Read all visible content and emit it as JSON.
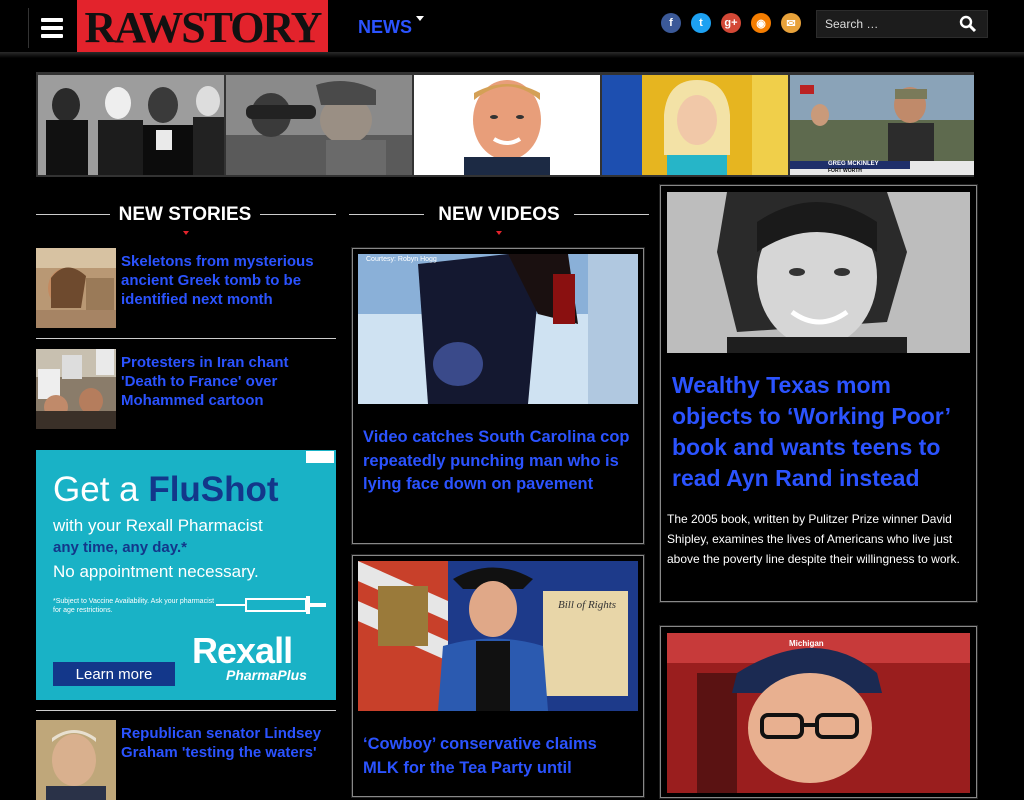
{
  "header": {
    "logo_text": "RAWSTORY",
    "nav_news": "NEWS",
    "search_placeholder": "Search …",
    "social": [
      {
        "icon": "facebook-icon",
        "glyph": "f",
        "color": "#3b5998"
      },
      {
        "icon": "twitter-icon",
        "glyph": "t",
        "color": "#1da1f2"
      },
      {
        "icon": "googleplus-icon",
        "glyph": "g+",
        "color": "#d34836"
      },
      {
        "icon": "rss-icon",
        "glyph": "◉",
        "color": "#f57d00"
      },
      {
        "icon": "email-icon",
        "glyph": "✉",
        "color": "#e8a23a"
      }
    ]
  },
  "strip": {
    "captions": [
      "GREG MCKINLEY",
      "FORT WORTH"
    ]
  },
  "new_stories": {
    "heading": "NEW STORIES",
    "items": [
      {
        "title": "Skeletons from mysterious ancient Greek tomb to be identified next month"
      },
      {
        "title": "Protesters in Iran chant 'Death to France' over Mohammed cartoon"
      },
      {
        "title": "Republican senator Lindsey Graham 'testing the waters'"
      }
    ]
  },
  "new_videos": {
    "heading": "NEW VIDEOS",
    "items": [
      {
        "title": "Video catches South Carolina cop repeatedly punching man who is lying face down on pavement",
        "credit": "Courtesy: Robyn Hogg"
      },
      {
        "title": "‘Cowboy’ conservative claims MLK for the Tea Party until",
        "sign_text": "Bill of Rights"
      }
    ]
  },
  "featured": [
    {
      "title": "Wealthy Texas mom objects to ‘Working Poor’ book and wants teens to read Ayn Rand instead",
      "excerpt": "The 2005 book, written by Pulitzer Prize winner David Shipley, examines the lives of Americans who live just above the poverty line despite their willingness to work."
    },
    {
      "cap_text": "Michigan"
    }
  ],
  "ad": {
    "line1_a": "Get a ",
    "line1_b": "FluShot",
    "line2": "with your Rexall Pharmacist",
    "line3": "any time, any day.*",
    "line4": "No appointment necessary.",
    "fine_print": "*Subject to Vaccine Availability. Ask your pharmacist for age restrictions.",
    "brand": "Rexall",
    "brand_sub": "PharmaPlus",
    "button": "Learn more"
  },
  "colors": {
    "brand_red": "#e3232c",
    "link_blue": "#2b53ff",
    "background": "#000000"
  }
}
